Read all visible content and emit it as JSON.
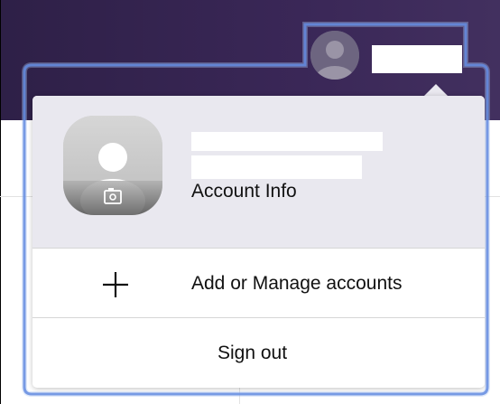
{
  "header": {
    "user_name": ""
  },
  "account_menu": {
    "name": "",
    "email": "",
    "account_info_label": "Account Info",
    "add_manage_label": "Add or Manage accounts",
    "sign_out_label": "Sign out"
  },
  "icons": {
    "avatar": "person-icon",
    "camera": "camera-icon",
    "plus": "plus-icon"
  },
  "colors": {
    "header_bg": "#2e2047",
    "focus_outline": "#3f6fd8",
    "menu_header_bg": "#e9e8ef"
  }
}
